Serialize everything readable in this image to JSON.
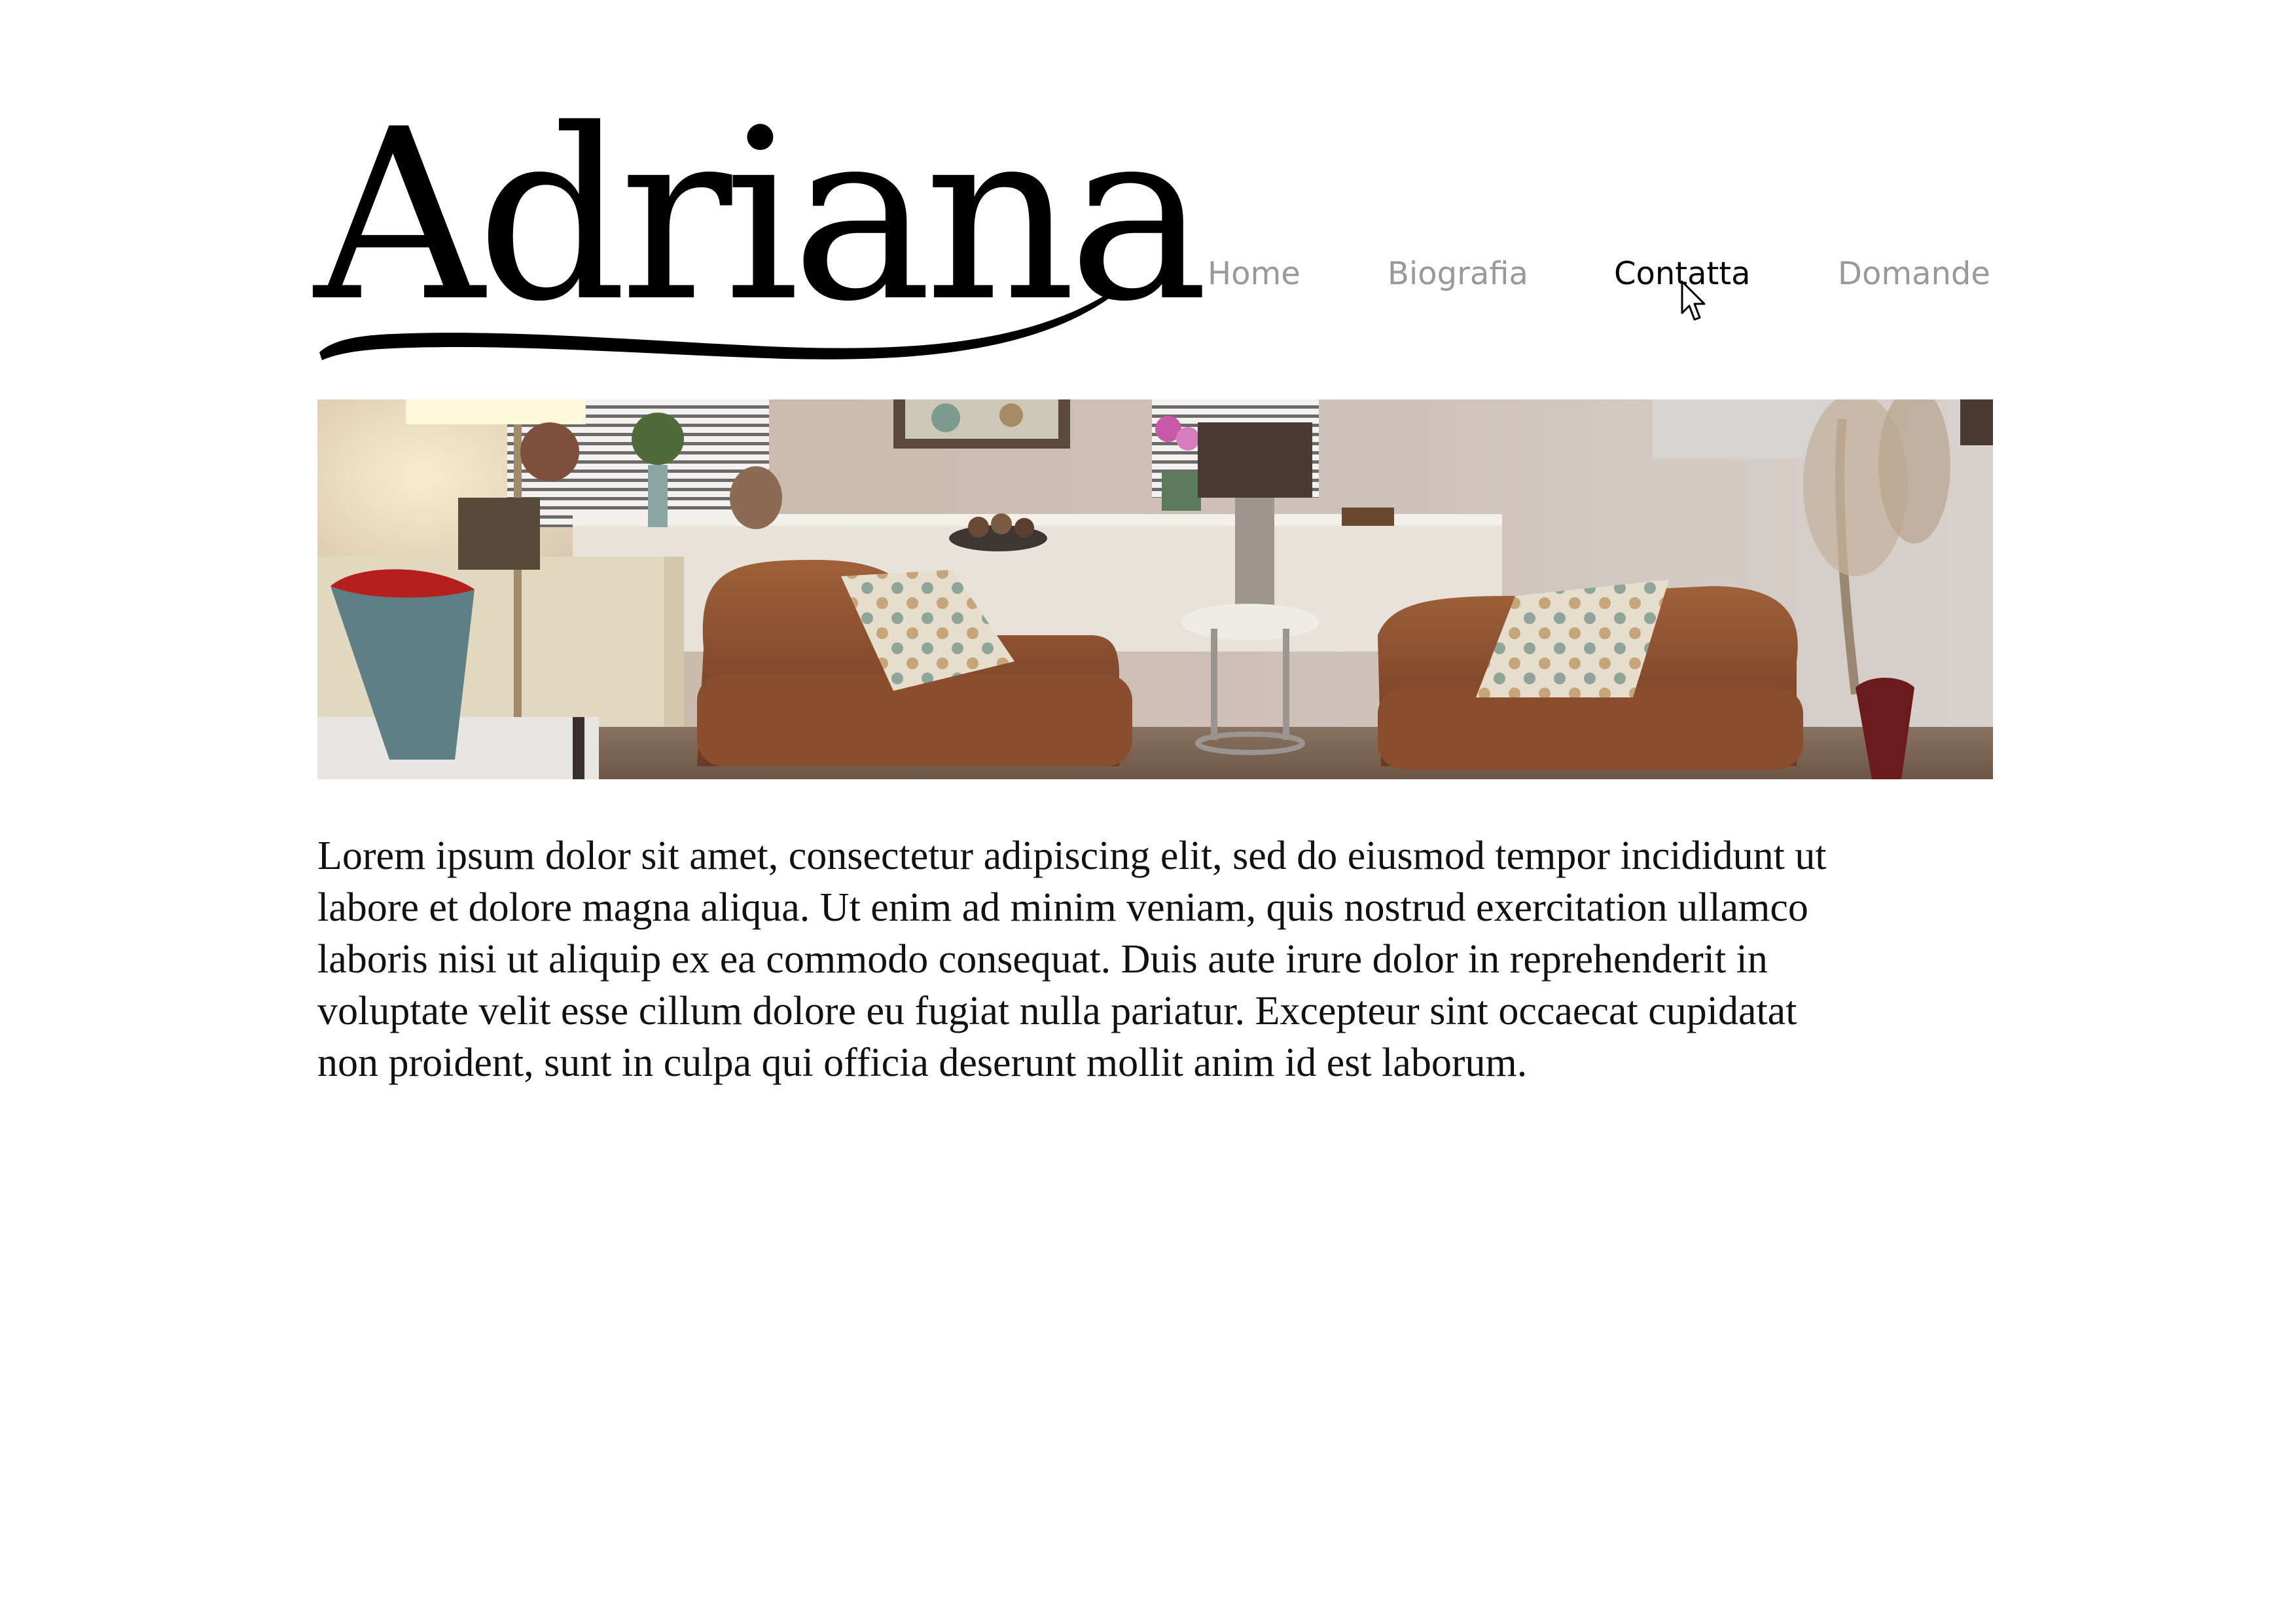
{
  "site": {
    "logo_text": "Adriana"
  },
  "nav": {
    "items": [
      {
        "label": "Home",
        "active": false
      },
      {
        "label": "Biografia",
        "active": false
      },
      {
        "label": "Contatta",
        "active": true
      },
      {
        "label": "Domande",
        "active": false
      }
    ]
  },
  "hero": {
    "alt": "room-photo"
  },
  "content": {
    "paragraph_line1": "Lorem ipsum dolor sit amet, consectetur adipiscing elit, sed do eiusmod tempor incididunt ut",
    "paragraph_line2": "labore et dolore magna aliqua. Ut enim ad minim veniam, quis nostrud exercitation ullamco",
    "paragraph_line3": "laboris nisi ut aliquip ex ea commodo consequat. Duis aute irure dolor in reprehenderit in",
    "paragraph_line4": "voluptate velit esse cillum dolore eu fugiat nulla pariatur. Excepteur sint occaecat cupidatat",
    "paragraph_line5": "non proident, sunt in culpa qui officia deserunt mollit anim id est laborum."
  },
  "colors": {
    "nav_inactive": "#999999",
    "nav_active": "#000000",
    "text": "#111111",
    "background": "#ffffff"
  },
  "icons": {
    "cursor": "mouse-pointer-icon"
  }
}
